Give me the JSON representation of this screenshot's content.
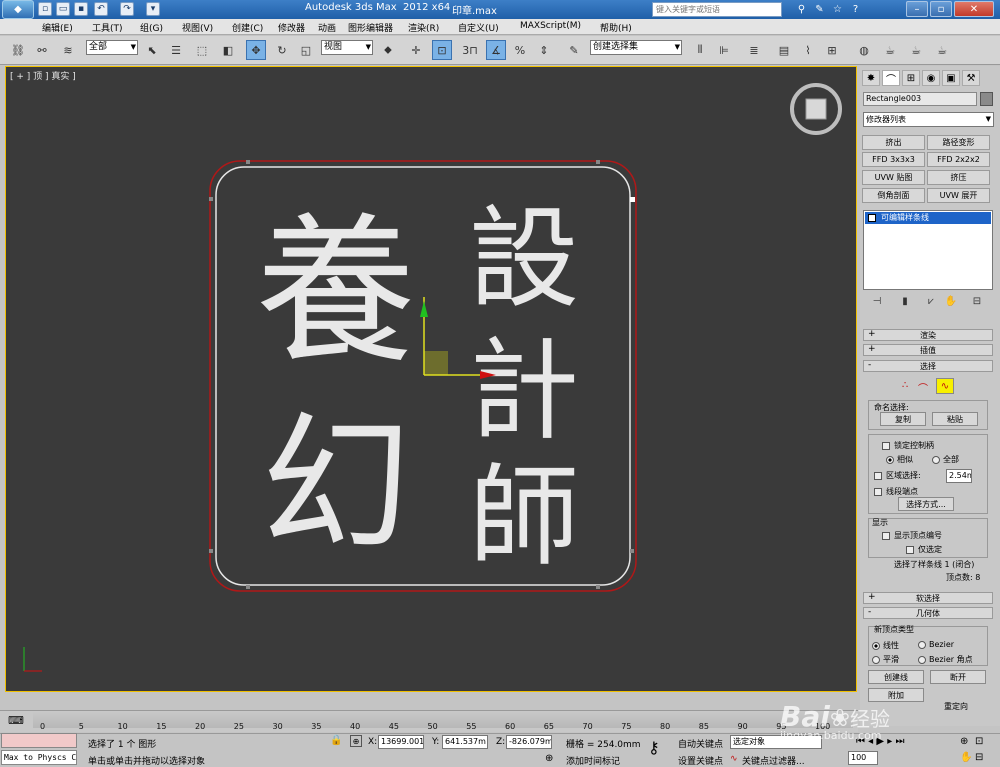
{
  "app": {
    "title": "Autodesk 3ds Max  2012 x64",
    "file": "印章.max",
    "search_placeholder": "键入关键字或短语"
  },
  "menu": [
    "编辑(E)",
    "工具(T)",
    "组(G)",
    "视图(V)",
    "创建(C)",
    "修改器",
    "动画",
    "图形编辑器",
    "渲染(R)",
    "自定义(U)",
    "MAXScript(M)",
    "帮助(H)"
  ],
  "toolbar": {
    "filter": "全部",
    "ref_coord": "视图",
    "snap_3": "3",
    "percent": "%",
    "named_sel": "创建选择集"
  },
  "viewport": {
    "label": "[ + ] 顶 ] 真实 ]"
  },
  "seal": {
    "glyph_left_top": "養",
    "glyph_left_bottom": "幻",
    "glyph_right_1": "設",
    "glyph_right_2": "計",
    "glyph_right_3": "師"
  },
  "panel": {
    "object_name": "Rectangle003",
    "modifier_list": "修改器列表",
    "buttons": [
      "挤出",
      "路径变形",
      "FFD 3x3x3",
      "FFD 2x2x2",
      "UVW 贴图",
      "挤压",
      "倒角剖面",
      "UVW 展开"
    ],
    "stack_item": "可编辑样条线",
    "rollouts": {
      "render": "渲染",
      "interp": "插值",
      "select": "选择",
      "soft": "软选择",
      "geometry": "几何体"
    },
    "named_selection": "命名选择:",
    "copy": "复制",
    "paste": "粘贴",
    "lock_handles": "锁定控制柄",
    "similar": "相似",
    "all": "全部",
    "area_select": "区域选择:",
    "area_value": "2.54m",
    "segment_end": "线段端点",
    "select_by": "选择方式...",
    "display": "显示",
    "show_vertex_numbers": "显示顶点编号",
    "selected_only": "仅选定",
    "selected_info": "选择了样条线 1 (闭合)",
    "vertex_count": "顶点数: 8",
    "new_vertex_type": "新顶点类型",
    "linear": "线性",
    "bezier": "Bezier",
    "smooth": "平滑",
    "bezier_corner": "Bezier 角点",
    "create_line": "创建线",
    "break": "断开",
    "reorient": "重定向",
    "attach": "附加"
  },
  "timeline": {
    "ticks": [
      "0",
      "5",
      "10",
      "15",
      "20",
      "25",
      "30",
      "35",
      "40",
      "45",
      "50",
      "55",
      "60",
      "65",
      "70",
      "75",
      "80",
      "85",
      "90",
      "95",
      "100"
    ]
  },
  "status": {
    "maxscript_text": "Max to Physcs C",
    "selected": "选择了 1 个 图形",
    "prompt": "单击或单击并拖动以选择对象",
    "x_label": "X:",
    "x_value": "13699.001",
    "y_label": "Y:",
    "y_value": "641.537m",
    "z_label": "Z:",
    "z_value": "-826.079m",
    "grid": "栅格 = 254.0mm",
    "add_time_tag": "添加时间标记",
    "auto_key": "自动关键点",
    "set_key": "设置关键点",
    "selected_obj": "选定对象",
    "key_filters": "关键点过滤器...",
    "frame": "100"
  },
  "watermark": {
    "brand": "Bai",
    "brand2": "经验",
    "url": "jingyan.baidu.com"
  },
  "colors": {
    "viewport_bg": "#3a3a3a",
    "selection_red": "#b01818",
    "accent_blue": "#1e64c8"
  }
}
